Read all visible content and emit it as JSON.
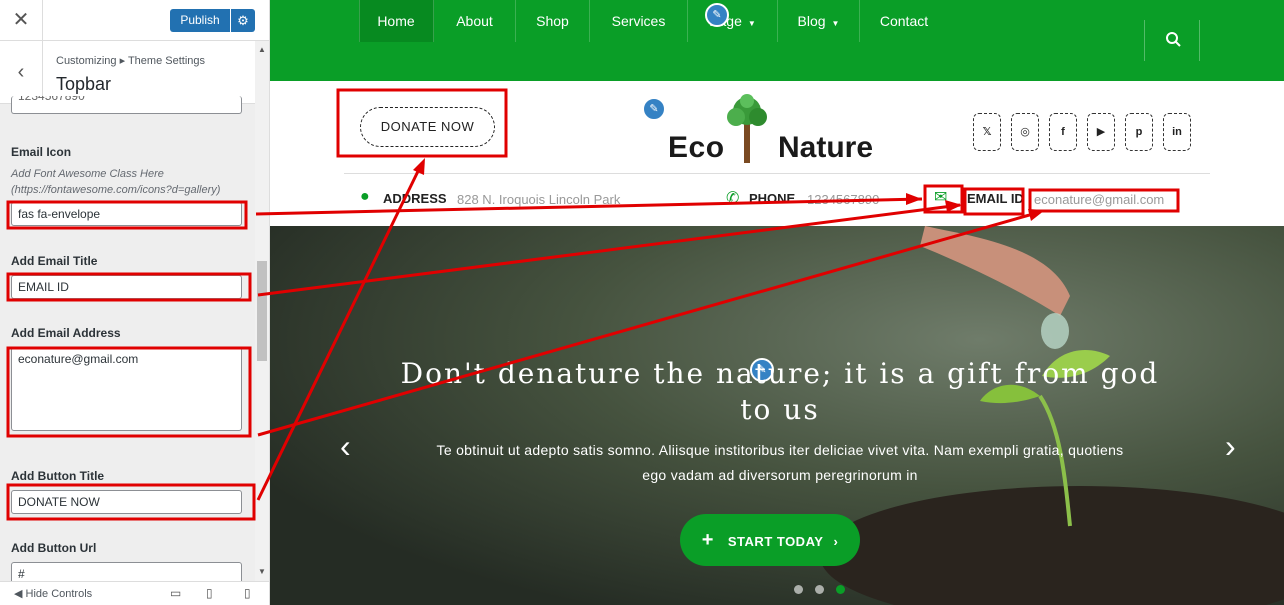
{
  "customizer": {
    "close_icon": "close-icon",
    "publish_label": "Publish",
    "gear_icon": "gear-icon",
    "breadcrumb": "Customizing ▸ Theme Settings",
    "section_title": "Topbar",
    "prev_value_partial": "1234567890",
    "controls": {
      "email_icon_label": "Email Icon",
      "email_icon_desc": "Add Font Awesome Class Here (https://fontawesome.com/icons?d=gallery)",
      "email_icon_value": "fas fa-envelope",
      "email_title_label": "Add Email Title",
      "email_title_value": "EMAIL ID",
      "email_address_label": "Add Email Address",
      "email_address_value": "econature@gmail.com",
      "button_title_label": "Add Button Title",
      "button_title_value": "DONATE NOW",
      "button_url_label": "Add Button Url",
      "button_url_value": "#"
    },
    "footer": {
      "hide_controls": "Hide Controls"
    }
  },
  "site": {
    "nav": [
      "Home",
      "About",
      "Shop",
      "Services",
      "Page",
      "Blog",
      "Contact"
    ],
    "donate_label": "DONATE NOW",
    "logo_word1": "Eco",
    "logo_word2": "Nature",
    "socials": [
      "twitter-icon",
      "instagram-icon",
      "facebook-icon",
      "youtube-icon",
      "pinterest-icon",
      "linkedin-icon"
    ],
    "info": {
      "address_label": "ADDRESS",
      "address_value": "828 N. Iroquois Lincoln Park",
      "phone_label": "PHONE",
      "phone_value": "1234567890",
      "email_label": "EMAIL ID",
      "email_value": "econature@gmail.com"
    },
    "hero": {
      "title": "Don't denature the nature; it is a gift from god to us",
      "text": "Te obtinuit ut adepto satis somno. Aliisque institoribus iter deliciae vivet vita. Nam exempli gratia, quotiens ego vadam ad diversorum peregrinorum in",
      "button": "START TODAY"
    }
  },
  "colors": {
    "brand_green": "#0a9e27",
    "wp_blue": "#2271b1",
    "annotation_red": "#e00000"
  }
}
